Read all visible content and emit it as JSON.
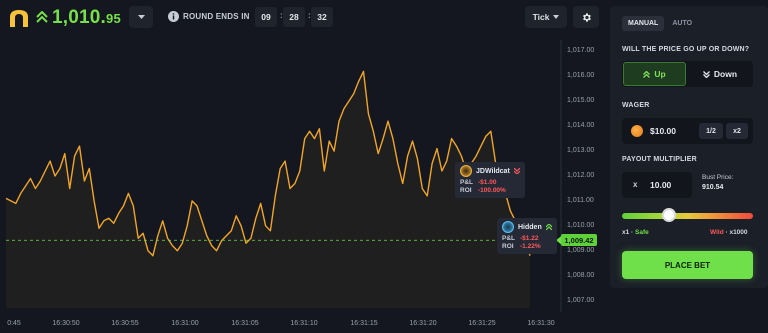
{
  "header": {
    "price_main": "1,010.",
    "price_dec": "95",
    "round_label": "ROUND ENDS IN",
    "timer": [
      "09",
      "28",
      "32"
    ],
    "tick_label": "Tick"
  },
  "chart_data": {
    "type": "line",
    "y_ticks": [
      "1,017.00",
      "1,016.00",
      "1,015.00",
      "1,014.00",
      "1,013.00",
      "1,012.00",
      "1,011.00",
      "1,010.00",
      "1,009.00",
      "1,008.00",
      "1,007.00"
    ],
    "x_ticks": [
      "0:45",
      "16:30:50",
      "16:30:55",
      "16:31:00",
      "16:31:05",
      "16:31:10",
      "16:31:15",
      "16:31:20",
      "16:31:25",
      "16:31:30"
    ],
    "ylim": [
      1006.7,
      1017.3
    ],
    "current_price": "1,009.42",
    "current_value": 1009.42,
    "series_values": [
      1011.1,
      1011.0,
      1010.9,
      1011.3,
      1011.6,
      1011.9,
      1011.5,
      1011.8,
      1012.2,
      1012.6,
      1012.0,
      1012.3,
      1012.9,
      1011.5,
      1012.8,
      1013.2,
      1011.8,
      1012.3,
      1011.0,
      1009.9,
      1010.2,
      1010.3,
      1010.1,
      1010.5,
      1010.8,
      1011.3,
      1010.8,
      1009.5,
      1009.7,
      1009.0,
      1008.8,
      1009.6,
      1010.2,
      1009.5,
      1009.2,
      1009.0,
      1009.3,
      1010.0,
      1011.0,
      1010.8,
      1010.2,
      1009.6,
      1009.2,
      1009.0,
      1009.4,
      1009.6,
      1009.8,
      1010.4,
      1010.0,
      1009.3,
      1009.5,
      1010.3,
      1010.9,
      1010.0,
      1009.8,
      1011.2,
      1012.3,
      1012.6,
      1011.5,
      1011.7,
      1012.2,
      1013.5,
      1013.8,
      1013.5,
      1013.9,
      1012.2,
      1013.4,
      1013.0,
      1014.2,
      1014.7,
      1015.0,
      1015.3,
      1015.8,
      1016.2,
      1014.5,
      1013.8,
      1012.9,
      1013.5,
      1014.2,
      1013.5,
      1012.5,
      1011.7,
      1012.8,
      1013.4,
      1012.7,
      1011.5,
      1011.2,
      1012.5,
      1013.1,
      1012.2,
      1012.6,
      1013.5,
      1013.2,
      1012.8,
      1012.2,
      1012.5,
      1012.8,
      1013.2,
      1013.6,
      1013.8,
      1012.5,
      1011.9,
      1011.3,
      1010.6,
      1010.2,
      1009.9,
      1009.4,
      1008.8
    ]
  },
  "bets": [
    {
      "name": "JDWildcat",
      "pl_label": "P&L",
      "pl": "-$1.00",
      "roi_label": "ROI",
      "roi": "-100.00%"
    },
    {
      "name": "Hidden",
      "pl_label": "P&L",
      "pl": "-$1.22",
      "roi_label": "ROI",
      "roi": "-1.22%"
    }
  ],
  "panel": {
    "tab_manual": "MANUAL",
    "tab_auto": "AUTO",
    "question": "WILL THE PRICE GO UP OR DOWN?",
    "up_label": "Up",
    "down_label": "Down",
    "wager_label": "WAGER",
    "wager_value": "$10.00",
    "half_label": "1/2",
    "double_label": "x2",
    "payout_label": "PAYOUT MULTIPLIER",
    "multiplier_x": "x",
    "multiplier_value": "10.00",
    "bust_label": "Bust Price:",
    "bust_value": "910.54",
    "safe_prefix": "x1 · ",
    "safe_word": "Safe",
    "wild_word": "Wild",
    "wild_suffix": " · x1000",
    "slider_level": 0.36,
    "place_bet": "PLACE BET"
  },
  "colors": {
    "accent_green": "#6fe04a",
    "line_orange": "#f0a52a",
    "loss_red": "#ff5a5a"
  }
}
